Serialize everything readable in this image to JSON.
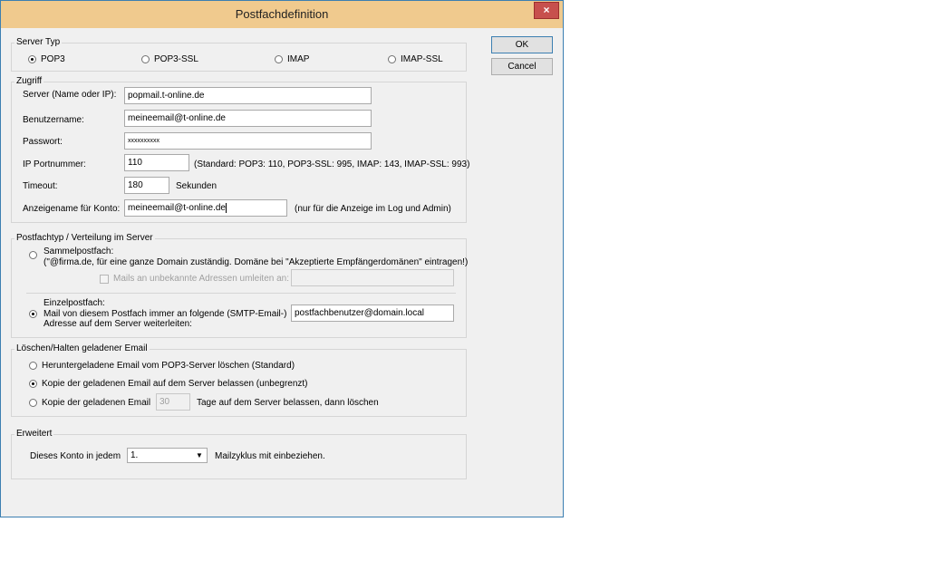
{
  "window": {
    "title": "Postfachdefinition",
    "close_glyph": "×"
  },
  "buttons": {
    "ok": "OK",
    "cancel": "Cancel"
  },
  "server_typ": {
    "legend": "Server Typ",
    "options": [
      "POP3",
      "POP3-SSL",
      "IMAP",
      "IMAP-SSL"
    ],
    "selected": "POP3"
  },
  "zugriff": {
    "legend": "Zugriff",
    "server_label": "Server (Name oder IP):",
    "server_value": "popmail.t-online.de",
    "benutzer_label": "Benutzername:",
    "benutzer_value": "meineemail@t-online.de",
    "passwort_label": "Passwort:",
    "passwort_value": "xxxxxxxxxx",
    "port_label": "IP Portnummer:",
    "port_value": "110",
    "port_hint": "(Standard: POP3: 110, POP3-SSL: 995, IMAP: 143, IMAP-SSL: 993)",
    "timeout_label": "Timeout:",
    "timeout_value": "180",
    "timeout_unit": "Sekunden",
    "anzeige_label": "Anzeigename für Konto:",
    "anzeige_value": "meineemail@t-online.de",
    "anzeige_hint": "(nur für die Anzeige im Log  und Admin)"
  },
  "postfachtyp": {
    "legend": "Postfachtyp / Verteilung im Server",
    "sammel_title": "Sammelpostfach:",
    "sammel_desc": "(\"@firma.de, für eine ganze Domain zuständig. Domäne bei \"Akzeptierte Empfängerdomänen\" eintragen!)",
    "mails_unknown_label": "Mails an unbekannte Adressen umleiten an:",
    "mails_unknown_value": "",
    "einzel_title": "Einzelpostfach:",
    "einzel_line1": "Mail von diesem Postfach immer an folgende (SMTP-Email-)",
    "einzel_line2": "Adresse auf dem Server weiterleiten:",
    "einzel_value": "postfachbenutzer@domain.local",
    "selected": "Einzelpostfach"
  },
  "loeschen": {
    "legend": "Löschen/Halten geladener Email",
    "option1": "Heruntergeladene Email vom POP3-Server löschen (Standard)",
    "option2": "Kopie der geladenen Email auf dem Server belassen (unbegrenzt)",
    "option3_prefix": "Kopie der geladenen Email",
    "option3_days": "30",
    "option3_suffix": "Tage auf dem Server belassen, dann löschen",
    "selected": "option2"
  },
  "erweitert": {
    "legend": "Erweitert",
    "prefix": "Dieses Konto in jedem",
    "select_value": "1.",
    "suffix": "Mailzyklus mit einbeziehen."
  }
}
